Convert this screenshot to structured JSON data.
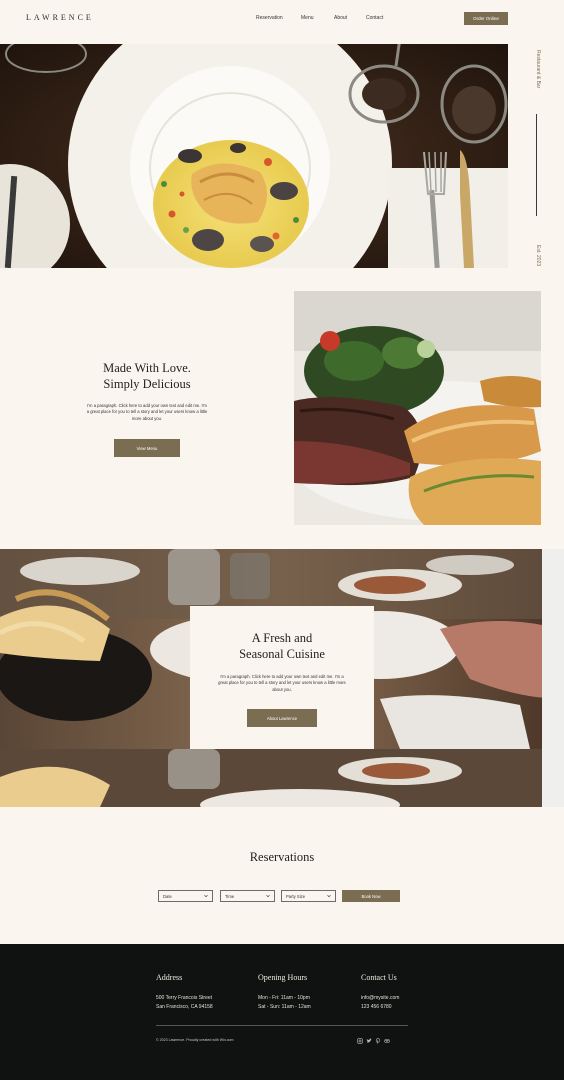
{
  "header": {
    "logo": "LAWRENCE",
    "nav": [
      "Reservation",
      "Menu",
      "About",
      "Contact"
    ],
    "order_button": "Order Online"
  },
  "hero": {
    "side_label": "Restaurant & Bar",
    "side_est": "Est. 2023"
  },
  "about": {
    "title_line1": "Made With Love.",
    "title_line2": "Simply Delicious",
    "paragraph": "I'm a paragraph. Click here to add your own text and edit me. I'm a great place for you to tell a story and let your users know a little more about you.",
    "button": "View Menu"
  },
  "fresh": {
    "title_line1": "A Fresh and",
    "title_line2": "Seasonal Cuisine",
    "paragraph": "I'm a paragraph. Click here to add your own text and edit me. I'm a great place for you to tell a story and let your users know a little more about you.",
    "button": "About Lawrence"
  },
  "reservations": {
    "title": "Reservations",
    "fields": [
      "Date",
      "Time",
      "Party Size"
    ],
    "book_button": "Book Now"
  },
  "footer": {
    "address_heading": "Address",
    "address_line1": "500 Terry Francois Street",
    "address_line2": "San Francisco, CA 94158",
    "hours_heading": "Opening Hours",
    "hours_line1": "Mon - Fri: 11am - 10pm",
    "hours_line2": "Sat - Sun: 11am - 12am",
    "contact_heading": "Contact Us",
    "contact_email": "info@mysite.com",
    "contact_phone": "123 456 6780",
    "copyright": "© 2023 Lawrence. Proudly created with Wix.com",
    "social_icons": [
      "instagram-icon",
      "twitter-icon",
      "pinterest-icon",
      "tripadvisor-icon"
    ]
  },
  "colors": {
    "accent": "#7a6d52",
    "background": "#faf6ef",
    "footer_bg": "#0f1210"
  }
}
